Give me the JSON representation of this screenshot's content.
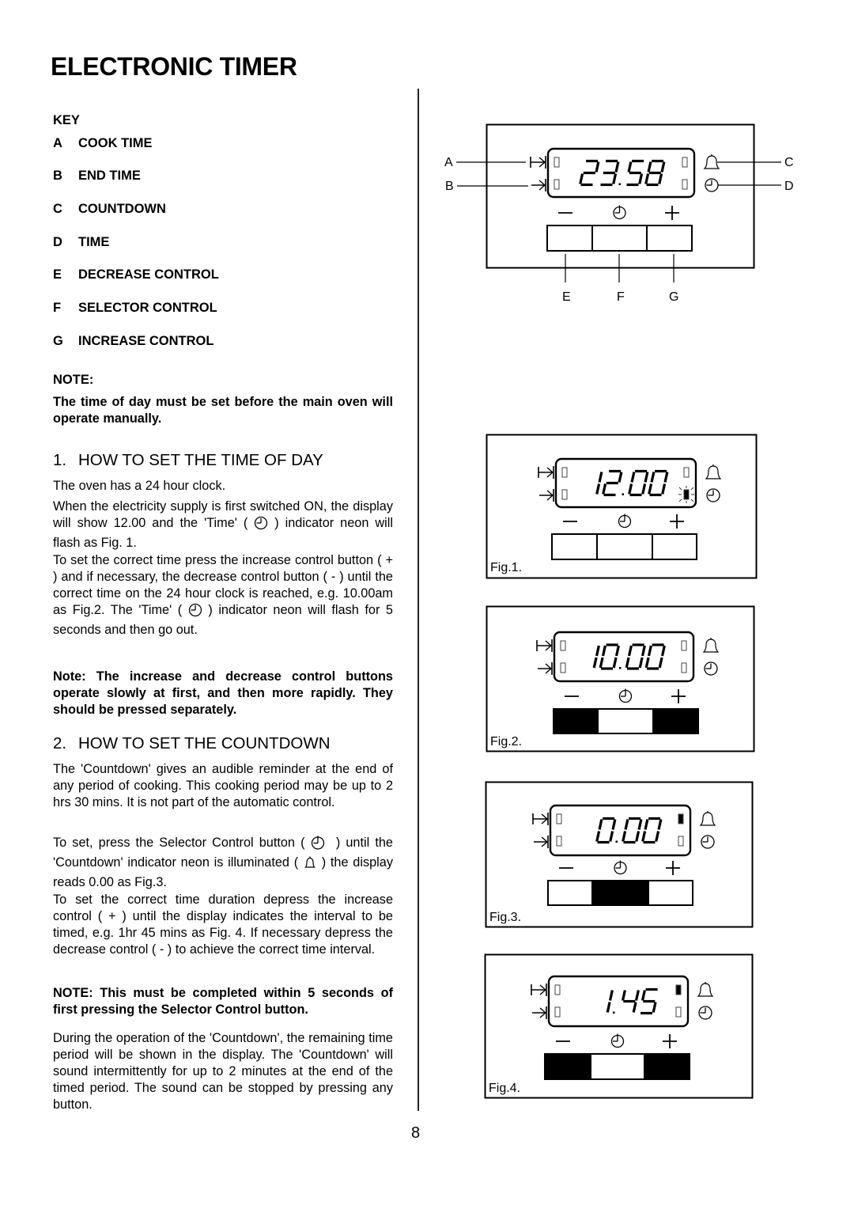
{
  "page": {
    "title": "ELECTRONIC TIMER",
    "page_number": "8"
  },
  "key": {
    "heading": "KEY",
    "items": [
      {
        "letter": "A",
        "label": "COOK TIME"
      },
      {
        "letter": "B",
        "label": "END TIME"
      },
      {
        "letter": "C",
        "label": "COUNTDOWN"
      },
      {
        "letter": "D",
        "label": "TIME"
      },
      {
        "letter": "E",
        "label": "DECREASE CONTROL"
      },
      {
        "letter": "F",
        "label": "SELECTOR CONTROL"
      },
      {
        "letter": "G",
        "label": "INCREASE CONTROL"
      }
    ]
  },
  "note": {
    "heading": "NOTE:",
    "text": "The time of day must be set before the main oven will operate manually."
  },
  "section1": {
    "number": "1.",
    "heading": "HOW TO SET THE TIME OF DAY",
    "p1": "The oven has a 24 hour clock.",
    "p2_before": "When the electricity supply is first switched ON, the display will show 12.00 and the 'Time' (",
    "p2_after": ") indicator neon will flash as Fig. 1.",
    "p3_before": "To set the correct time press the increase control button ( + ) and if necessary, the decrease control button ( - ) until the correct time on the 24 hour clock is reached, e.g. 10.00am as Fig.2.  The 'Time' (",
    "p3_after": ") indicator neon will flash for 5 seconds and then go out.",
    "note": "Note: The increase and decrease control buttons operate slowly at first, and then more rapidly. They should be pressed separately."
  },
  "section2": {
    "number": "2.",
    "heading": "HOW TO SET THE COUNTDOWN",
    "p1": "The 'Countdown' gives an audible reminder at the end of any period of cooking.  This cooking period may be  up to 2 hrs 30 mins.  It is not part of the automatic control.",
    "p2_a": "To set, press the Selector Control button (",
    "p2_b": ") until the 'Countdown' indicator neon is illuminated (",
    "p2_c": ") the display reads 0.00 as Fig.3.",
    "p3": "To set the correct time duration depress the increase control ( + ) until the display indicates the interval to be timed, e.g. 1hr 45 mins as Fig. 4.  If necessary depress the decrease control ( - ) to achieve the correct time interval.",
    "note": "NOTE:  This must be completed within 5 seconds of first pressing the Selector Control button.",
    "p4": "During the operation of the 'Countdown', the remaining time period will be shown in the display. The 'Countdown' will sound intermittently for up to 2 minutes at the end of the timed period.  The sound can be stopped by pressing any button."
  },
  "figures": {
    "main": {
      "display": "23.58",
      "callouts": {
        "A": "A",
        "B": "B",
        "C": "C",
        "D": "D",
        "E": "E",
        "F": "F",
        "G": "G"
      },
      "button_symbols": {
        "decrease": "−",
        "increase": "+"
      },
      "buttons_filled": [
        false,
        false,
        false
      ],
      "indicators": {
        "countdown": "off",
        "time": "off"
      }
    },
    "fig1": {
      "caption": "Fig.1.",
      "display": "12.00",
      "buttons_filled": [
        false,
        false,
        false
      ],
      "indicators": {
        "countdown": "off",
        "time": "flashing"
      }
    },
    "fig2": {
      "caption": "Fig.2.",
      "display": "10.00",
      "buttons_filled": [
        true,
        false,
        true
      ],
      "indicators": {
        "countdown": "off",
        "time": "off"
      }
    },
    "fig3": {
      "caption": "Fig.3.",
      "display": "0.00",
      "buttons_filled": [
        false,
        true,
        false
      ],
      "indicators": {
        "countdown": "on",
        "time": "off"
      }
    },
    "fig4": {
      "caption": "Fig.4.",
      "display": "1.45",
      "buttons_filled": [
        true,
        false,
        true
      ],
      "indicators": {
        "countdown": "on",
        "time": "off"
      }
    }
  },
  "icons": {
    "cook_time": "cook-time-arrow-icon",
    "end_time": "end-time-arrow-icon",
    "countdown": "bell-icon",
    "time": "clock-icon",
    "selector": "selector-clock-icon"
  }
}
